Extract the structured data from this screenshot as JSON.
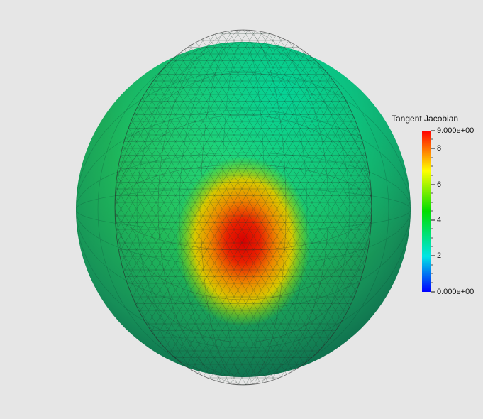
{
  "colorbar": {
    "title": "Tangent Jacobian",
    "max_label": "9.000e+00",
    "min_label": "0.000e+00",
    "tick_labels": [
      "8",
      "6",
      "4",
      "2"
    ],
    "range": [
      0,
      9
    ],
    "colors": [
      "#0000ff",
      "#00e5e5",
      "#00dd00",
      "#ffff00",
      "#ff0000"
    ]
  },
  "scene": {
    "background": "#e6e6e6",
    "surface_colormap": "rainbow",
    "hotspot_value": 9,
    "surrounding_value": 4.5,
    "wireframe_color": "#404040"
  }
}
